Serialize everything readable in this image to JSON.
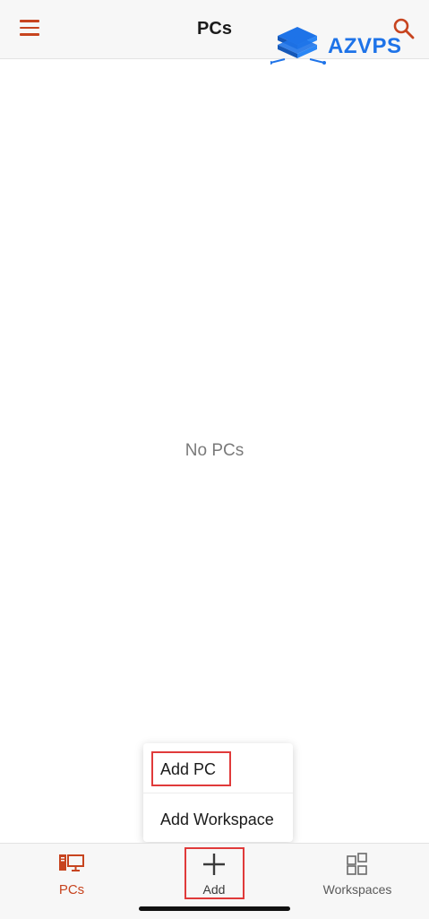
{
  "header": {
    "title": "PCs",
    "menu_icon": "hamburger-menu-icon",
    "search_icon": "search-icon"
  },
  "watermark": {
    "text": "AZVPS",
    "icon": "server-stack-logo"
  },
  "main": {
    "empty_text": "No PCs"
  },
  "add_menu": {
    "items": [
      {
        "label": "Add PC"
      },
      {
        "label": "Add Workspace"
      }
    ]
  },
  "bottom_nav": {
    "items": [
      {
        "label": "PCs",
        "icon": "monitor-icon",
        "active": true
      },
      {
        "label": "Add",
        "icon": "plus-icon",
        "active": false
      },
      {
        "label": "Workspaces",
        "icon": "workspaces-grid-icon",
        "active": false
      }
    ]
  },
  "colors": {
    "accent": "#c7441f",
    "watermark": "#1e73e8",
    "highlight": "#e03a3a"
  }
}
